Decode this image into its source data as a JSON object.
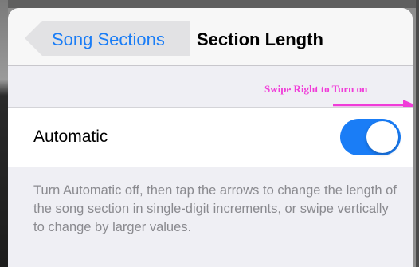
{
  "navbar": {
    "back_label": "Song Sections",
    "title": "Section Length"
  },
  "hint": {
    "text": "Swipe Right to Turn on",
    "color": "#f03cd8"
  },
  "setting": {
    "label": "Automatic",
    "toggle_on": true,
    "toggle_color": "#1a7df6"
  },
  "footer": {
    "text": "Turn Automatic off, then tap the arrows to change the length of the song section in single-digit increments, or swipe vertically to change by larger values."
  }
}
